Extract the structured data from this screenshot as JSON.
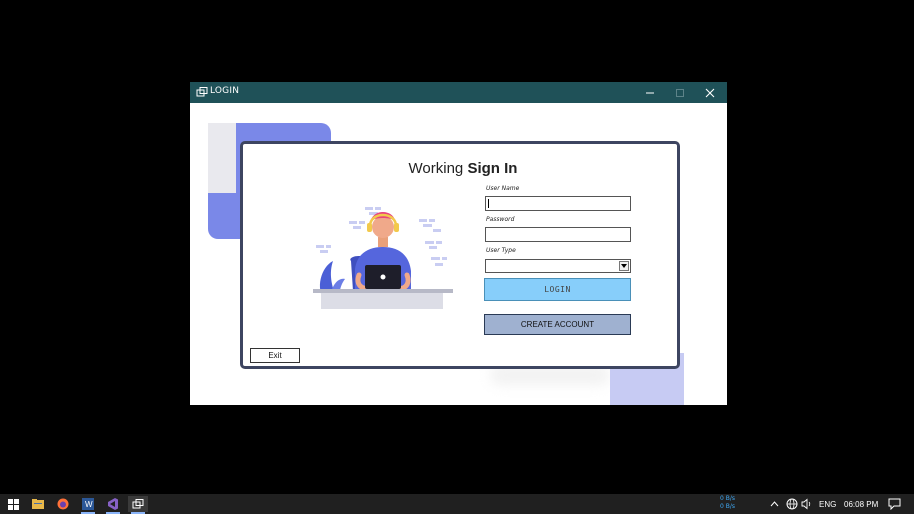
{
  "window": {
    "title": "LOGIN",
    "colors": {
      "titlebar": "#1f5158",
      "card_border": "#3d4561",
      "accent_blue": "#7a88e8"
    }
  },
  "form": {
    "heading_regular": "Working",
    "heading_bold": "Sign In",
    "username_label": "User Name",
    "username_value": "",
    "password_label": "Password",
    "password_value": "",
    "usertype_label": "User Type",
    "usertype_selected": "",
    "login_button": "LOGIN",
    "create_account_button": "CREATE ACCOUNT",
    "exit_button": "Exit",
    "colors": {
      "login_button": "#87cefa",
      "create_button": "#9fb1d0"
    }
  },
  "taskbar": {
    "icons": [
      "windows-start-icon",
      "file-explorer-icon",
      "firefox-icon",
      "word-icon",
      "visual-studio-icon",
      "app-window-icon"
    ],
    "net_up": "0 B/s",
    "net_down": "0 B/s",
    "language": "ENG",
    "time": "06:08 PM"
  }
}
